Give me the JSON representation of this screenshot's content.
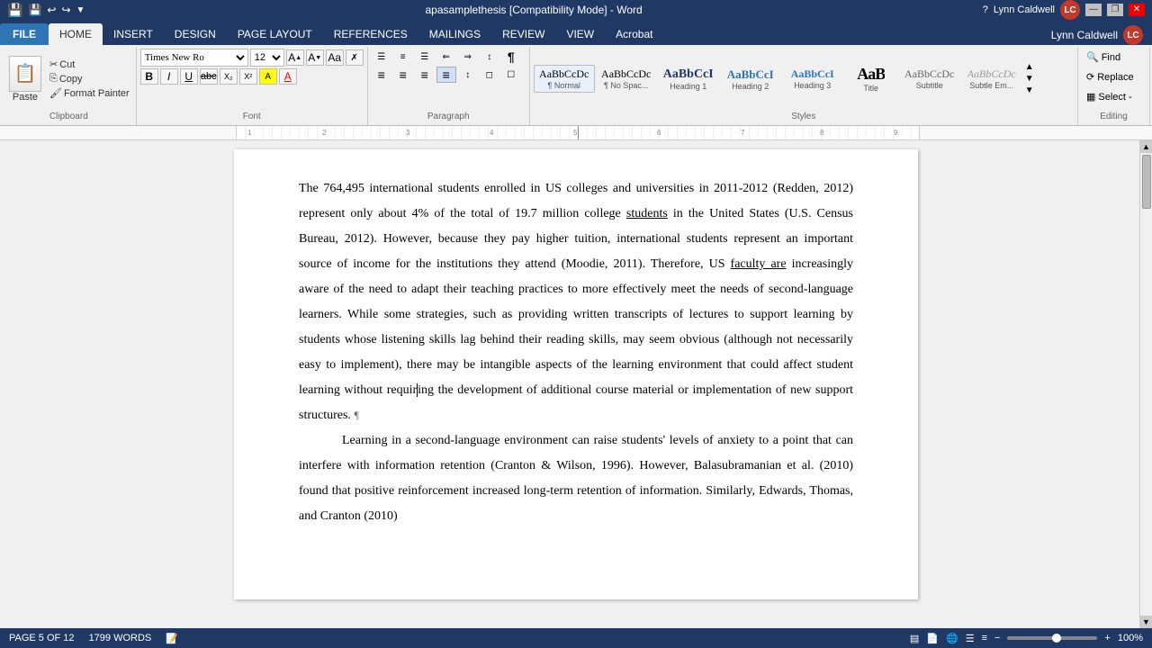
{
  "titlebar": {
    "title": "apasamplethesis [Compatibility Mode] - Word",
    "user": "Lynn Caldwell",
    "minimize": "—",
    "restore": "❐",
    "close": "✕"
  },
  "ribbon": {
    "tabs": [
      "FILE",
      "HOME",
      "INSERT",
      "DESIGN",
      "PAGE LAYOUT",
      "REFERENCES",
      "MAILINGS",
      "REVIEW",
      "VIEW",
      "Acrobat"
    ],
    "active_tab": "HOME",
    "clipboard": {
      "label": "Clipboard",
      "paste": "Paste",
      "cut": "Cut",
      "copy": "Copy",
      "format_painter": "Format Painter"
    },
    "font": {
      "label": "Font",
      "name": "Times New Ro",
      "size": "12",
      "bold": "B",
      "italic": "I",
      "underline": "U",
      "strikethrough": "abc",
      "subscript": "X₂",
      "superscript": "X²",
      "text_color": "A",
      "highlight": "A",
      "change_case": "Aa",
      "clear_format": "✗"
    },
    "paragraph": {
      "label": "Paragraph",
      "bullets": "≡",
      "numbering": "1.",
      "multi": "☰",
      "indent_less": "⇐",
      "indent_more": "⇒",
      "sort": "↕",
      "show_hide": "¶",
      "align_left": "≡",
      "align_center": "≡",
      "align_right": "≡",
      "justify": "≡",
      "line_spacing": "↕",
      "shading": "◻",
      "borders": "☐"
    },
    "styles": {
      "label": "Styles",
      "items": [
        {
          "name": "Normal",
          "label": "¶ Normal",
          "font_size": "12px",
          "font_weight": "normal",
          "color": "#000"
        },
        {
          "name": "No Spacing",
          "label": "¶ No Spac...",
          "font_size": "12px",
          "font_weight": "normal",
          "color": "#000"
        },
        {
          "name": "Heading 1",
          "label": "Heading 1",
          "font_size": "14px",
          "font_weight": "bold",
          "color": "#1f3864"
        },
        {
          "name": "Heading 2",
          "label": "Heading 2",
          "font_size": "13px",
          "font_weight": "bold",
          "color": "#2e75b6"
        },
        {
          "name": "Heading 3",
          "label": "Heading 3",
          "font_size": "12px",
          "font_weight": "bold",
          "color": "#2e75b6"
        },
        {
          "name": "Title",
          "label": "Title",
          "font_size": "18px",
          "font_weight": "bold",
          "color": "#000"
        },
        {
          "name": "Subtitle",
          "label": "Subtitle",
          "font_size": "12px",
          "font_weight": "normal",
          "color": "#666"
        },
        {
          "name": "Subtle Em.",
          "label": "Subtle Em...",
          "font_size": "12px",
          "font_weight": "normal",
          "color": "#666"
        }
      ]
    },
    "editing": {
      "label": "Editing",
      "find": "Find",
      "replace": "Replace",
      "select": "Select -"
    }
  },
  "document": {
    "paragraphs": [
      {
        "type": "body",
        "indent": false,
        "text": "The 764,495 international students enrolled in US colleges and universities in 2011-2012 (Redden, 2012) represent only about 4% of the total of 19.7 million college students in the United States (U.S. Census Bureau, 2012). However, because they pay higher tuition, international students represent an important source of income for the institutions they attend (Moodie, 2011). Therefore, US faculty are increasingly aware of the need to adapt their teaching practices to more effectively meet the needs of second-language learners. While some strategies, such as providing written transcripts of lectures to support learning by students whose listening skills lag behind their reading skills, may seem obvious (although not necessarily easy to implement), there may be intangible aspects of the learning environment that could affect student learning without requiring the development of additional course material or implementation of new support structures. ¶"
      },
      {
        "type": "body",
        "indent": true,
        "text": "Learning in a second-language environment can raise students' levels of anxiety to a point that can interfere with information retention (Cranton & Wilson, 1996). However, Balasubramanian et al. (2010) found that positive reinforcement increased long-term retention of information. Similarly, Edwards, Thomas, and Cranton (2010)"
      }
    ],
    "underlined_words": [
      "faculty are"
    ],
    "cursor_position": "after 'requiring'"
  },
  "statusbar": {
    "page": "PAGE 5 OF 12",
    "words": "1799 WORDS",
    "zoom": "100%",
    "view_icons": [
      "print-layout",
      "full-screen-reading",
      "web-layout",
      "outline",
      "draft"
    ]
  }
}
